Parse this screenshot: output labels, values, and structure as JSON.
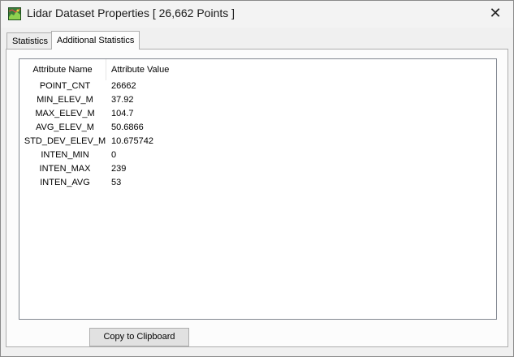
{
  "window": {
    "title": "Lidar Dataset Properties [ 26,662 Points ]",
    "close_glyph": "✕"
  },
  "tabs": [
    {
      "label": "Statistics",
      "active": false
    },
    {
      "label": "Additional Statistics",
      "active": true
    }
  ],
  "listview": {
    "columns": [
      "Attribute Name",
      "Attribute Value"
    ],
    "rows": [
      {
        "name": "POINT_CNT",
        "value": "26662"
      },
      {
        "name": "MIN_ELEV_M",
        "value": "37.92"
      },
      {
        "name": "MAX_ELEV_M",
        "value": "104.7"
      },
      {
        "name": "AVG_ELEV_M",
        "value": "50.6866"
      },
      {
        "name": "STD_DEV_ELEV_M",
        "value": "10.675742"
      },
      {
        "name": "INTEN_MIN",
        "value": "0"
      },
      {
        "name": "INTEN_MAX",
        "value": "239"
      },
      {
        "name": "INTEN_AVG",
        "value": "53"
      }
    ]
  },
  "buttons": {
    "copy_label": "Copy to Clipboard"
  }
}
